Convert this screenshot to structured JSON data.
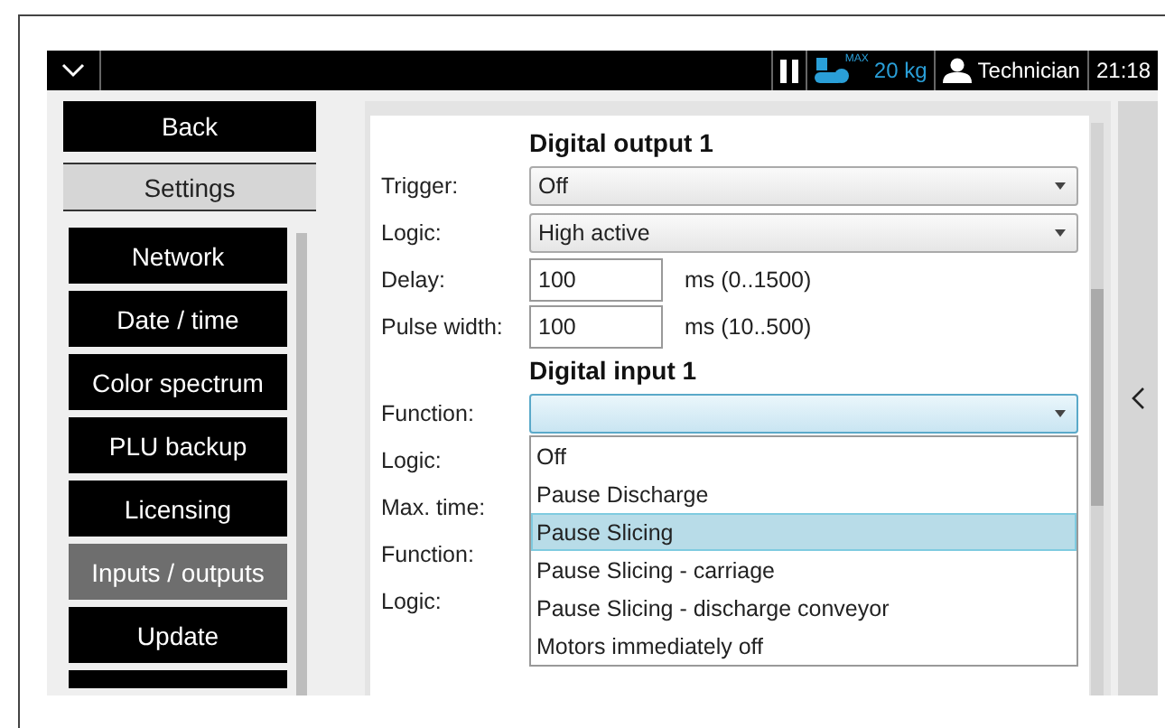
{
  "top_bar": {
    "max_label": "MAX",
    "weight": "20 kg",
    "user": "Technician",
    "time": "21:18"
  },
  "sidebar": {
    "back": "Back",
    "section": "Settings",
    "items": [
      {
        "label": "Network",
        "selected": false
      },
      {
        "label": "Date / time",
        "selected": false
      },
      {
        "label": "Color spectrum",
        "selected": false
      },
      {
        "label": "PLU backup",
        "selected": false
      },
      {
        "label": "Licensing",
        "selected": false
      },
      {
        "label": "Inputs / outputs",
        "selected": true
      },
      {
        "label": "Update",
        "selected": false
      }
    ]
  },
  "form": {
    "sections": [
      {
        "title": "Digital output 1",
        "rows": [
          {
            "kind": "select",
            "label": "Trigger:",
            "value": "Off",
            "expanded": false
          },
          {
            "kind": "select",
            "label": "Logic:",
            "value": "High active",
            "expanded": false
          },
          {
            "kind": "number",
            "label": "Delay:",
            "value": "100",
            "unit": "ms (0..1500)"
          },
          {
            "kind": "number",
            "label": "Pulse width:",
            "value": "100",
            "unit": "ms (10..500)"
          }
        ]
      },
      {
        "title": "Digital input 1",
        "rows": [
          {
            "kind": "select",
            "label": "Function:",
            "expanded": true,
            "options": [
              {
                "label": "Off",
                "selected": false
              },
              {
                "label": "Pause Discharge",
                "selected": false
              },
              {
                "label": "Pause Slicing",
                "selected": true
              },
              {
                "label": "Pause Slicing - carriage",
                "selected": false
              },
              {
                "label": "Pause Slicing - discharge conveyor",
                "selected": false
              },
              {
                "label": "Motors immediately off",
                "selected": false
              }
            ]
          },
          {
            "kind": "label",
            "label": "Logic:"
          },
          {
            "kind": "label",
            "label": "Max. time:"
          }
        ]
      },
      {
        "rows": [
          {
            "kind": "label",
            "label": "Function:"
          },
          {
            "kind": "label",
            "label": "Logic:"
          }
        ]
      }
    ]
  }
}
